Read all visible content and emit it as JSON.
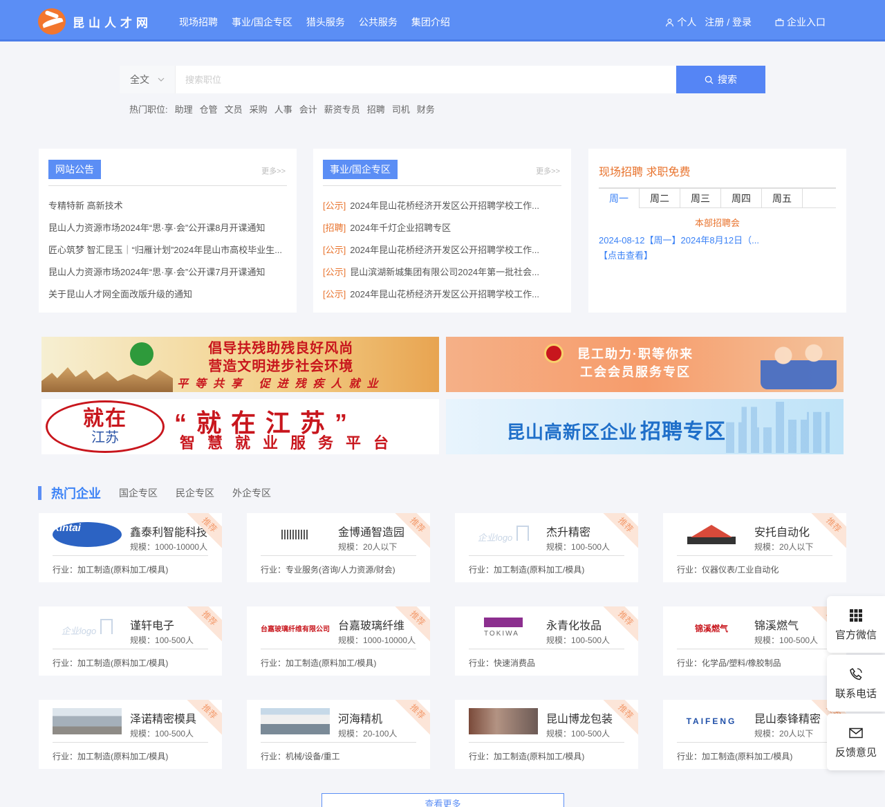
{
  "header": {
    "logo_text": "昆山人才网",
    "nav": [
      "现场招聘",
      "事业/国企专区",
      "猎头服务",
      "公共服务",
      "集团介绍"
    ],
    "personal": "个人",
    "register_login": "注册 / 登录",
    "enterprise": "企业入口"
  },
  "search": {
    "type": "全文",
    "placeholder": "搜索职位",
    "button": "搜索",
    "hot_label": "热门职位:",
    "hot_keywords": [
      "助理",
      "仓管",
      "文员",
      "采购",
      "人事",
      "会计",
      "薪资专员",
      "招聘",
      "司机",
      "财务"
    ]
  },
  "notice": {
    "title": "网站公告",
    "more": "更多>>",
    "items": [
      "专精特新 高新技术",
      "昆山人力资源市场2024年“思·享·会”公开课8月开课通知",
      "匠心筑梦 智汇昆玉｜“归雁计划”2024年昆山市高校毕业生...",
      "昆山人力资源市场2024年“思·享·会”公开课7月开课通知",
      "关于昆山人才网全面改版升级的通知"
    ]
  },
  "soe": {
    "title": "事业/国企专区",
    "more": "更多>>",
    "items": [
      {
        "prefix": "[公示]",
        "text": "2024年昆山花桥经济开发区公开招聘学校工作..."
      },
      {
        "prefix": "[招聘]",
        "text": "2024年千灯企业招聘专区"
      },
      {
        "prefix": "[公示]",
        "text": "2024年昆山花桥经济开发区公开招聘学校工作..."
      },
      {
        "prefix": "[公示]",
        "text": "昆山滨湖新城集团有限公司2024年第一批社会..."
      },
      {
        "prefix": "[公示]",
        "text": "2024年昆山花桥经济开发区公开招聘学校工作..."
      }
    ]
  },
  "fair": {
    "title": "现场招聘 求职免费",
    "days": [
      "周一",
      "周二",
      "周三",
      "周四",
      "周五"
    ],
    "sub": "本部招聘会",
    "line": "2024-08-12【周一】2024年8月12日（...",
    "link": "【点击查看】"
  },
  "banners": {
    "b1_line1": "倡导扶残助残良好风尚",
    "b1_line2": "营造文明进步社会环境",
    "b1_line3": "平等共享 促进残疾人就业",
    "b2_line1": "昆工助力·职等你来",
    "b2_line2": "工会会员服务专区",
    "b3_circle_big": "就在",
    "b3_circle_small": "江苏",
    "b3_title": "“就在江苏”",
    "b3_sub": "智慧就业服务平台",
    "b4_text": "昆山高新区企业",
    "b4_strong": "招聘专区"
  },
  "hot_companies": {
    "title": "热门企业",
    "tabs": [
      "国企专区",
      "民企专区",
      "外企专区"
    ],
    "ribbon": "推荐",
    "scale_label": "规模：",
    "industry_label": "行业：",
    "cards": [
      {
        "name": "鑫泰利智能科技",
        "scale": "1000-10000人",
        "industry": "加工制造(原料加工/模具)",
        "logo": "xintai",
        "logo_text": "Xintai"
      },
      {
        "name": "金博通智造园",
        "scale": "20人以下",
        "industry": "专业服务(咨询/人力资源/财会)",
        "logo": "stripes",
        "logo_text": ""
      },
      {
        "name": "杰升精密",
        "scale": "100-500人",
        "industry": "加工制造(原料加工/模具)",
        "logo": "gray",
        "logo_text": "企业logo"
      },
      {
        "name": "安托自动化",
        "scale": "20人以下",
        "industry": "仪器仪表/工业自动化",
        "logo": "autotek",
        "logo_text": ""
      },
      {
        "name": "谨轩电子",
        "scale": "100-500人",
        "industry": "加工制造(原料加工/模具)",
        "logo": "gray",
        "logo_text": "企业logo"
      },
      {
        "name": "台嘉玻璃纤维",
        "scale": "1000-10000人",
        "industry": "加工制造(原料加工/模具)",
        "logo": "taijia",
        "logo_text": "台嘉玻璃纤维有限公司"
      },
      {
        "name": "永青化妆品",
        "scale": "100-500人",
        "industry": "快速消费品",
        "logo": "tokiwa",
        "logo_text": ""
      },
      {
        "name": "锦溪燃气",
        "scale": "100-500人",
        "industry": "化学品/塑料/橡胶制品",
        "logo": "jinxi",
        "logo_text": "锦溪燃气"
      },
      {
        "name": "泽诺精密模具",
        "scale": "100-500人",
        "industry": "加工制造(原料加工/模具)",
        "logo": "photo",
        "logo_text": ""
      },
      {
        "name": "河海精机",
        "scale": "20-100人",
        "industry": "机械/设备/重工",
        "logo": "photo2",
        "logo_text": ""
      },
      {
        "name": "昆山博龙包装",
        "scale": "100-500人",
        "industry": "加工制造(原料加工/模具)",
        "logo": "photo3",
        "logo_text": ""
      },
      {
        "name": "昆山泰锋精密",
        "scale": "20人以下",
        "industry": "加工制造(原料加工/模具)",
        "logo": "taifeng",
        "logo_text": "TAIFENG"
      }
    ],
    "more_button": "查看更多"
  },
  "float": {
    "wechat": "官方微信",
    "phone": "联系电话",
    "feedback": "反馈意见"
  }
}
